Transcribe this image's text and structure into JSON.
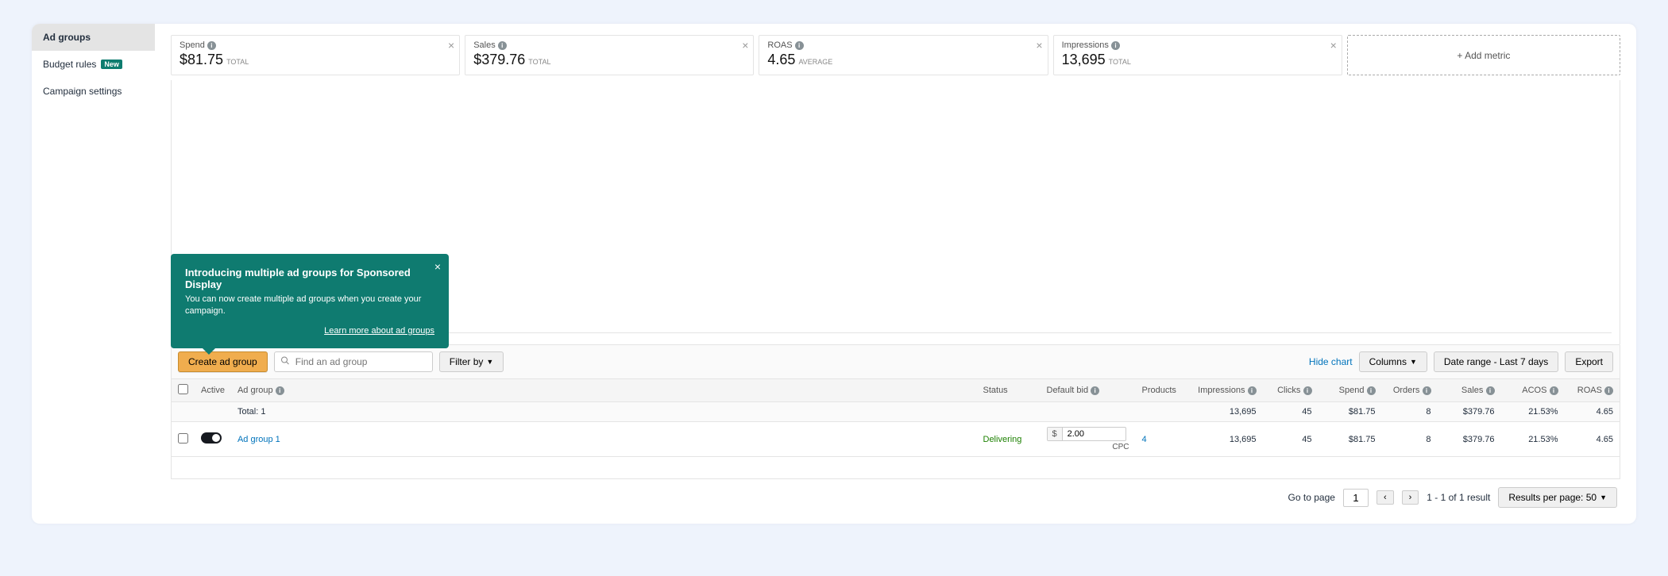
{
  "sidebar": {
    "items": [
      {
        "label": "Ad groups",
        "active": true
      },
      {
        "label": "Budget rules",
        "badge": "New"
      },
      {
        "label": "Campaign settings"
      }
    ]
  },
  "metrics": [
    {
      "label": "Spend",
      "value": "$81.75",
      "sub": "TOTAL"
    },
    {
      "label": "Sales",
      "value": "$379.76",
      "sub": "TOTAL"
    },
    {
      "label": "ROAS",
      "value": "4.65",
      "sub": "AVERAGE"
    },
    {
      "label": "Impressions",
      "value": "13,695",
      "sub": "TOTAL"
    }
  ],
  "add_metric": "+ Add metric",
  "popover": {
    "title": "Introducing multiple ad groups for Sponsored Display",
    "body": "You can now create multiple ad groups when you create your campaign.",
    "link": "Learn more about ad groups"
  },
  "toolbar": {
    "create": "Create ad group",
    "search_placeholder": "Find an ad group",
    "filter": "Filter by",
    "hide_chart": "Hide chart",
    "columns": "Columns",
    "date_range": "Date range - Last 7 days",
    "export": "Export"
  },
  "table": {
    "headers": {
      "active": "Active",
      "ad_group": "Ad group",
      "status": "Status",
      "default_bid": "Default bid",
      "products": "Products",
      "impressions": "Impressions",
      "clicks": "Clicks",
      "spend": "Spend",
      "orders": "Orders",
      "sales": "Sales",
      "acos": "ACOS",
      "roas": "ROAS"
    },
    "total_row": {
      "label": "Total: 1",
      "impressions": "13,695",
      "clicks": "45",
      "spend": "$81.75",
      "orders": "8",
      "sales": "$379.76",
      "acos": "21.53%",
      "roas": "4.65"
    },
    "rows": [
      {
        "name": "Ad group 1",
        "status": "Delivering",
        "bid_currency": "$",
        "bid_value": "2.00",
        "bid_type": "CPC",
        "products": "4",
        "impressions": "13,695",
        "clicks": "45",
        "spend": "$81.75",
        "orders": "8",
        "sales": "$379.76",
        "acos": "21.53%",
        "roas": "4.65"
      }
    ]
  },
  "footer": {
    "goto": "Go to page",
    "page": "1",
    "results": "1 - 1 of 1 result",
    "per_page": "Results per page: 50"
  }
}
